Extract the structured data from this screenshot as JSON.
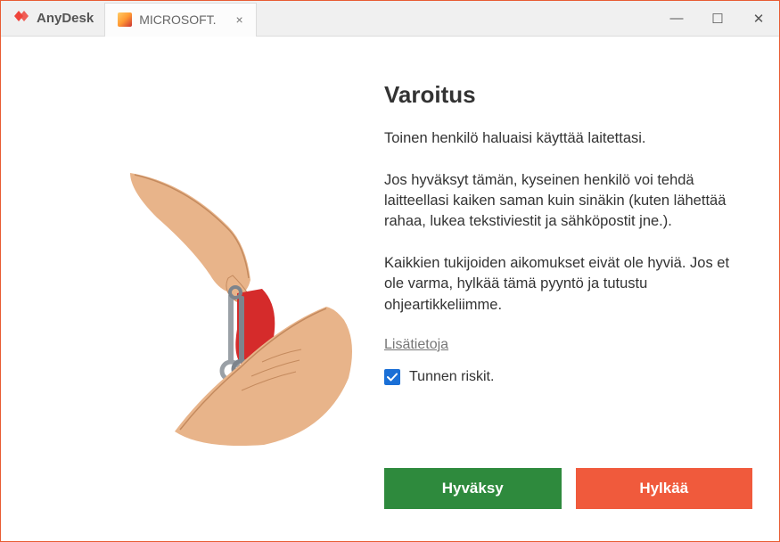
{
  "app": {
    "name": "AnyDesk"
  },
  "tab": {
    "label": "MICROSOFT.",
    "close_glyph": "×"
  },
  "window": {
    "minimize_glyph": "—",
    "maximize_glyph": "☐",
    "close_glyph": "✕"
  },
  "warning": {
    "heading": "Varoitus",
    "paragraph1": "Toinen henkilö haluaisi käyttää laitettasi.",
    "paragraph2": "Jos hyväksyt tämän, kyseinen henkilö voi tehdä laitteellasi kaiken saman kuin sinäkin (kuten lähettää rahaa, lukea tekstiviestit ja sähköpostit jne.).",
    "paragraph3": "Kaikkien tukijoiden aikomukset eivät ole hyviä. Jos et ole varma, hylkää tämä pyyntö ja tutustu ohjeartikkeliimme.",
    "learn_more": "Lisätietoja",
    "checkbox_label": "Tunnen riskit.",
    "checkbox_checked": true
  },
  "buttons": {
    "accept": "Hyväksy",
    "decline": "Hylkää"
  },
  "colors": {
    "accent": "#e85c33",
    "accept": "#2e8a3d",
    "decline": "#f05a3c",
    "checkbox": "#1a6fd6"
  }
}
